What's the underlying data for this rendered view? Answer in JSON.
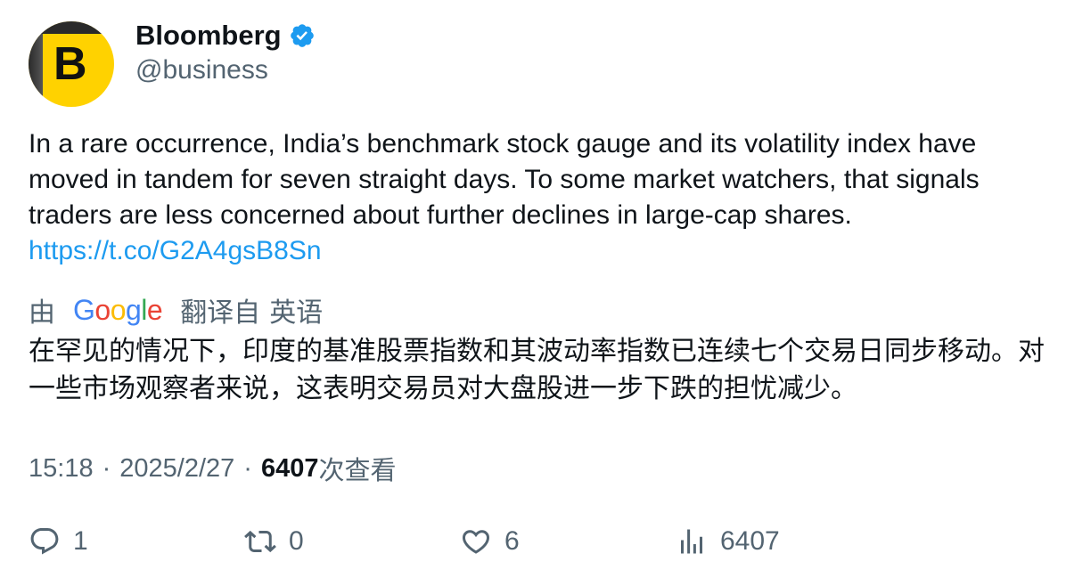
{
  "author": {
    "avatar_letter": "B",
    "name": "Bloomberg",
    "handle": "@business",
    "verified_icon": "verified-badge-icon",
    "brand_color": "#ffd200",
    "verified_color": "#1d9bf0"
  },
  "tweet": {
    "text": "In a rare occurrence, India’s benchmark stock gauge and its volatility index have moved in tandem for seven straight days. To some market watchers, that signals traders are less concerned about further declines in large-cap shares.",
    "link": "https://t.co/G2A4gsB8Sn",
    "link_color": "#1d9bf0"
  },
  "translation_bar": {
    "prefix": "由",
    "google_logo": [
      "G",
      "o",
      "o",
      "g",
      "l",
      "e"
    ],
    "translated_from": "翻译自",
    "language": "英语"
  },
  "translation": {
    "text": "在罕见的情况下，印度的基准股票指数和其波动率指数已连续七个交易日同步移动。对一些市场观察者来说，这表明交易员对大盘股进一步下跌的担忧减少。"
  },
  "meta": {
    "time": "15:18",
    "separator": "·",
    "date": "2025/2/27",
    "views_count": "6407",
    "views_label": "次查看"
  },
  "actions": {
    "replies": "1",
    "retweets": "0",
    "likes": "6",
    "views": "6407"
  }
}
